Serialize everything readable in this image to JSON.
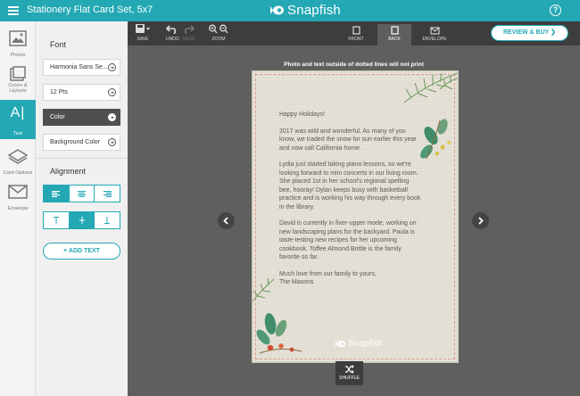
{
  "header": {
    "title": "Stationery Flat Card Set, 5x7",
    "brand": "Snapfish",
    "help_glyph": "?"
  },
  "rail": {
    "items": [
      {
        "label": "Photos",
        "icon": "photo-icon"
      },
      {
        "label": "Colors & Layouts",
        "icon": "layouts-icon"
      },
      {
        "label": "Text",
        "icon": "text-icon",
        "glyph": "A|"
      },
      {
        "label": "Card Options",
        "icon": "card-options-icon"
      },
      {
        "label": "Envelope",
        "icon": "envelope-icon"
      }
    ]
  },
  "panel": {
    "font_heading": "Font",
    "font_family": "Harmonia Sans Se...",
    "font_size": "12 Pts",
    "color_label": "Color",
    "background_color_label": "Background Color",
    "alignment_heading": "Alignment",
    "horizontal_align_selected": "left",
    "vertical_align_selected": "middle",
    "add_text_label": "+ ADD TEXT"
  },
  "toolbar": {
    "save": "SAVE",
    "undo": "UNDO",
    "redo": "REDO",
    "zoom": "ZOOM",
    "views": [
      "FRONT",
      "BACK",
      "ENVELOPE"
    ],
    "active_view": "BACK",
    "review_buy": "REVIEW & BUY ❯"
  },
  "canvas": {
    "print_notice": "Photo and text outside of dotted lines will not print",
    "card_brand": "Snapfish",
    "shuffle": "SHUFFLE",
    "message": [
      "Happy Holidays!",
      "2017 was wild and wonderful. As many of you know, we traded the snow for sun earlier this year and now call California home.",
      "Lydia just started taking piano lessons, so we're looking forward to mini concerts in our living room. She placed 1st in her school's regional spelling bee, hooray! Dylan keeps busy with basketball practice and is working his way through every book in the library.",
      "David is currently in fixer-upper mode, working on new landscaping plans for the backyard. Paula is taste-testing new recipes for her upcoming cookbook. Toffee Almond Brittle is the family favorite so far.",
      "Much love from our family to yours,\nThe Masons"
    ]
  },
  "colors": {
    "accent": "#23a8b4",
    "toolbar": "#3d3d3d",
    "canvas_bg": "#5f5f5f",
    "card": "#e6e2d8",
    "print_border": "#e49a8a"
  }
}
